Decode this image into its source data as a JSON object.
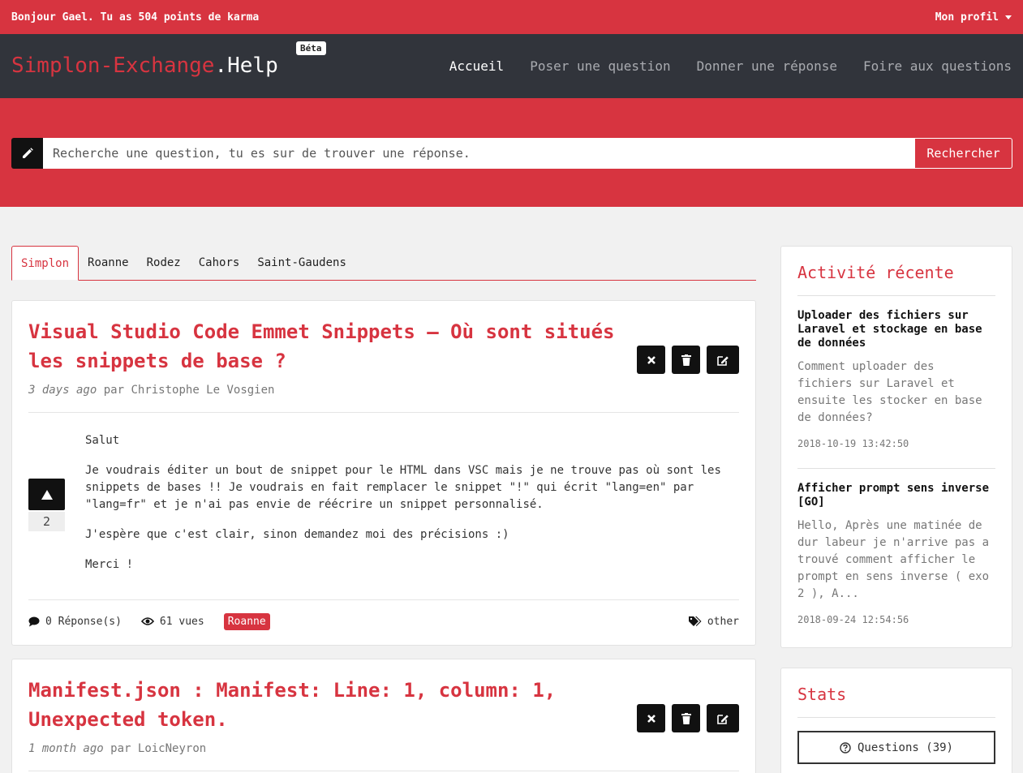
{
  "topbar": {
    "greeting": "Bonjour Gael. Tu as 504 points de karma",
    "profile_label": "Mon profil"
  },
  "brand": {
    "name_part1": "Simplon-Exchange",
    "name_part2": ".Help",
    "badge": "Béta"
  },
  "nav": {
    "items": [
      {
        "label": "Accueil",
        "active": true
      },
      {
        "label": "Poser une question",
        "active": false
      },
      {
        "label": "Donner une réponse",
        "active": false
      },
      {
        "label": "Foire aux questions",
        "active": false
      }
    ]
  },
  "search": {
    "placeholder": "Recherche une question, tu es sur de trouver une réponse.",
    "button_label": "Rechercher"
  },
  "tabs": [
    {
      "label": "Simplon",
      "active": true
    },
    {
      "label": "Roanne",
      "active": false
    },
    {
      "label": "Rodez",
      "active": false
    },
    {
      "label": "Cahors",
      "active": false
    },
    {
      "label": "Saint-Gaudens",
      "active": false
    }
  ],
  "questions": [
    {
      "title": "Visual Studio Code Emmet Snippets – Où sont situés les snippets de base ?",
      "time": "3 days ago",
      "by": "par",
      "author": "Christophe Le Vosgien",
      "votes": "2",
      "body": [
        "Salut",
        "Je voudrais éditer un bout de snippet pour le HTML dans VSC mais je ne trouve pas où sont les snippets de bases !! Je voudrais en fait remplacer le snippet \"!\" qui écrit \"lang=en\" par \"lang=fr\" et je n'ai pas envie de réécrire un snippet personnalisé.",
        "J'espère que c'est clair, sinon demandez moi des précisions :)",
        "Merci !"
      ],
      "answers": "0 Réponse(s)",
      "views": "61 vues",
      "campus": "Roanne",
      "tag": "other"
    },
    {
      "title": "Manifest.json : Manifest: Line: 1, column: 1, Unexpected token.",
      "time": "1 month ago",
      "by": "par",
      "author": "LoicNeyron"
    }
  ],
  "sidebar": {
    "activity_title": "Activité récente",
    "activities": [
      {
        "title": "Uploader des fichiers sur Laravel et stockage en base de données",
        "desc": "Comment uploader des fichiers sur Laravel et ensuite les stocker en base de données?",
        "date": "2018-10-19 13:42:50"
      },
      {
        "title": "Afficher prompt sens inverse [GO]",
        "desc": "Hello, Après une matinée de dur labeur je n'arrive pas a trouvé comment afficher le prompt en sens inverse ( exo 2 ), A...",
        "date": "2018-09-24 12:54:56"
      }
    ],
    "stats_title": "Stats",
    "stats_button": "Questions (39)"
  },
  "colors": {
    "brand_red": "#d73440",
    "navbar": "#31343b",
    "page_bg": "#f1f1f1"
  },
  "icons": [
    "pencil-icon",
    "close-icon",
    "trash-icon",
    "edit-icon",
    "arrow-up-icon",
    "comment-icon",
    "eye-icon",
    "tags-icon",
    "question-circle-icon",
    "caret-down-icon"
  ]
}
